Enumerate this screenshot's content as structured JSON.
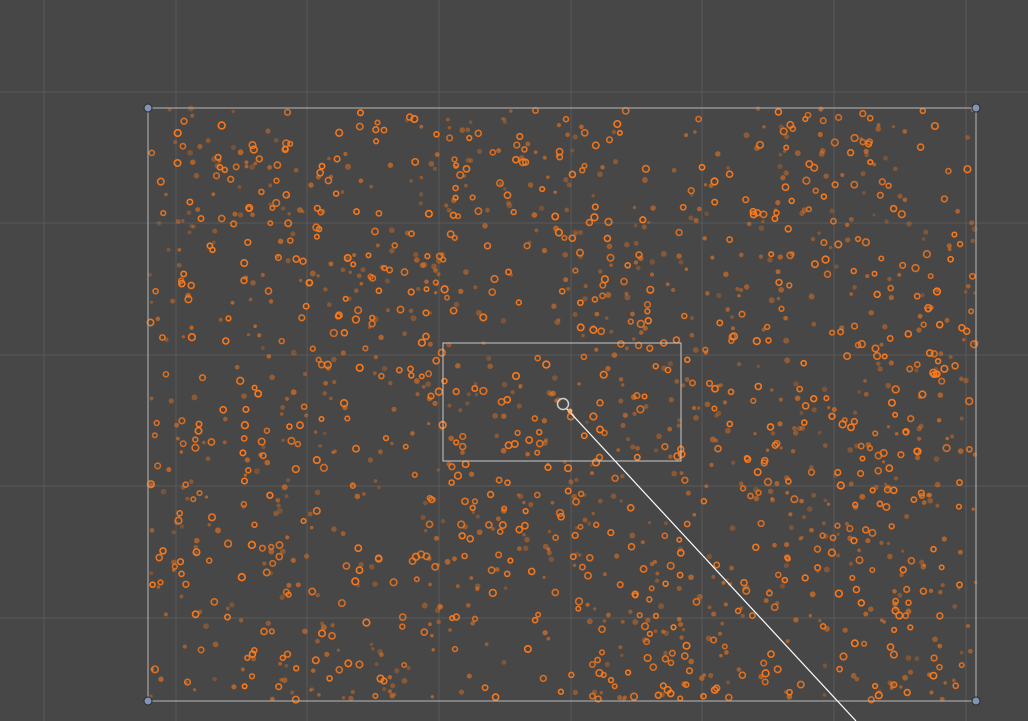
{
  "viewport": {
    "background": "#474747",
    "grid_color": "#5a5a5a",
    "particle_color": "#ff7a1a",
    "particle_core": "#ffb066",
    "frame_color": "#b8b8b8",
    "handle_color": "#7f93b5",
    "pivot_color": "#c8c8c8",
    "line_color": "#ffffff",
    "seed": 1337,
    "particle_count": 1700,
    "density_variation": "clustered"
  },
  "objects": [
    {
      "name": "spawn-area",
      "kind": "rect-bounds"
    },
    {
      "name": "inner-selection",
      "kind": "rect-bounds"
    },
    {
      "name": "pivot",
      "kind": "pivot-gizmo"
    },
    {
      "name": "direction-line",
      "kind": "line"
    }
  ]
}
